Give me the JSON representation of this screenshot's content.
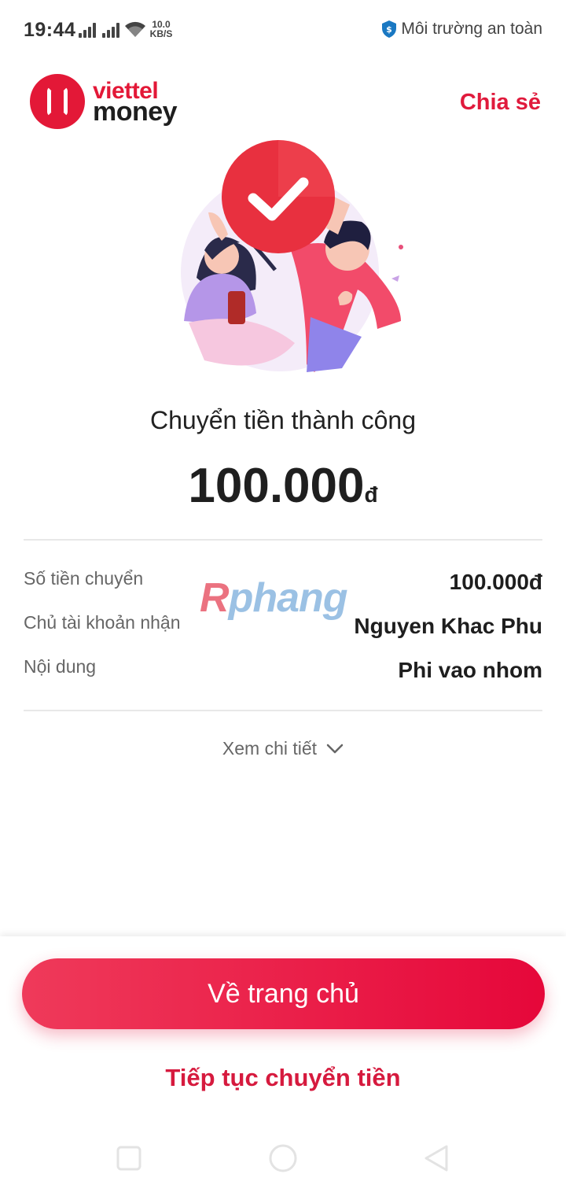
{
  "status_bar": {
    "time": "19:44",
    "net_speed_value": "10.0",
    "net_speed_unit": "KB/S",
    "secure_text": "Môi trường an toàn",
    "icons": [
      "signal-icon",
      "signal-icon",
      "wifi-icon",
      "shield-icon"
    ]
  },
  "header": {
    "logo_line1": "viettel",
    "logo_line2": "money",
    "share_label": "Chia sẻ"
  },
  "result": {
    "title": "Chuyển tiền thành công",
    "amount": "100.000",
    "currency": "đ"
  },
  "details": {
    "rows": [
      {
        "label": "Số tiền chuyển",
        "value": "100.000đ"
      },
      {
        "label": "Chủ tài khoản nhận",
        "value": "Nguyen Khac Phu"
      },
      {
        "label": "Nội dung",
        "value": "Phi vao nhom"
      }
    ],
    "view_more": "Xem chi tiết"
  },
  "watermark": {
    "first": "R",
    "rest": "phang"
  },
  "actions": {
    "home": "Về trang chủ",
    "continue": "Tiếp tục chuyển tiền"
  },
  "colors": {
    "brand": "#e31837",
    "button_start": "#ef3a5a",
    "button_end": "#e6073a"
  }
}
